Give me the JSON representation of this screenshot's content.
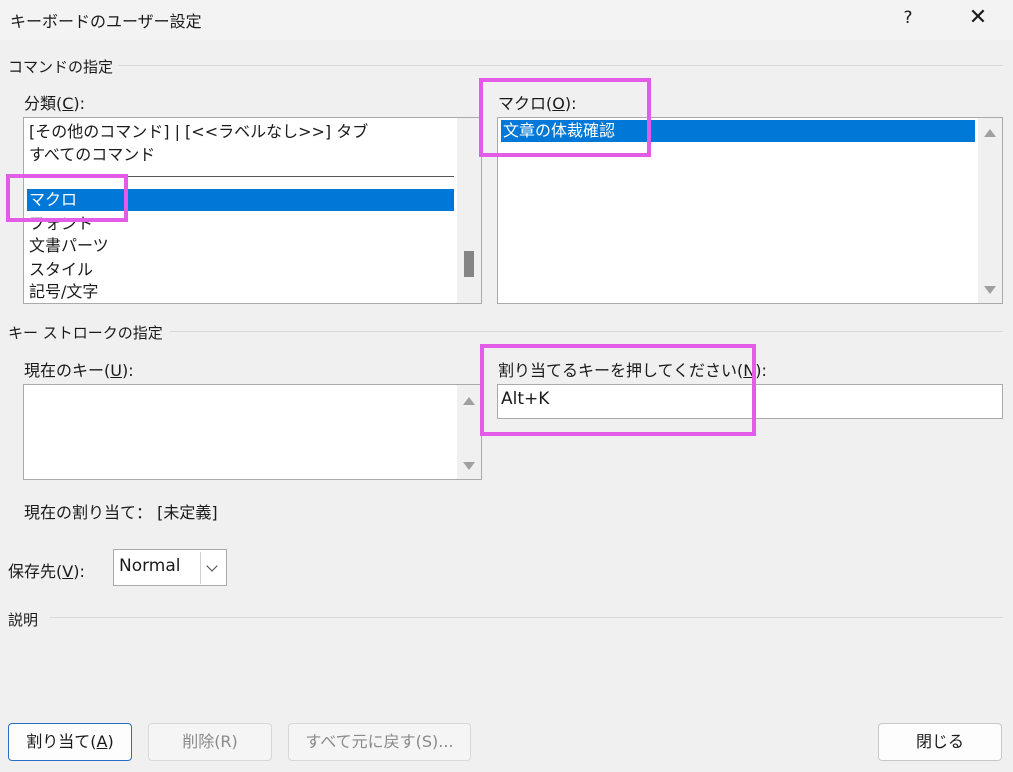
{
  "window": {
    "title": "キーボードのユーザー設定",
    "help": "?",
    "close": "✕"
  },
  "commands_group": {
    "label": "コマンドの指定",
    "categories": {
      "label_prefix": "分類(",
      "label_key": "C",
      "label_suffix": "):",
      "items": [
        {
          "text": "[その他のコマンド] | [<<ラベルなし>>] タブ",
          "selected": false
        },
        {
          "text": "すべてのコマンド",
          "selected": false
        },
        {
          "text": "マクロ",
          "selected": true
        },
        {
          "text": "フォント",
          "selected": false
        },
        {
          "text": "文書パーツ",
          "selected": false
        },
        {
          "text": "スタイル",
          "selected": false
        },
        {
          "text": "記号/文字",
          "selected": false
        }
      ]
    },
    "macros": {
      "label_prefix": "マクロ(",
      "label_key": "O",
      "label_suffix": "):",
      "items": [
        {
          "text": "文章の体裁確認",
          "selected": true
        }
      ]
    }
  },
  "keystroke_group": {
    "label": "キー ストロークの指定",
    "current_keys": {
      "label_prefix": "現在のキー(",
      "label_key": "U",
      "label_suffix": "):"
    },
    "new_key": {
      "label_prefix": "割り当てるキーを押してください(",
      "label_key": "N",
      "label_suffix": "):",
      "value": "Alt+K"
    }
  },
  "current_assignment": {
    "label": "現在の割り当て：",
    "value": "[未定義]"
  },
  "save_in": {
    "label_prefix": "保存先(",
    "label_key": "V",
    "label_suffix": "):",
    "value": "Normal"
  },
  "description": {
    "label": "説明"
  },
  "buttons": {
    "assign": {
      "prefix": "割り当て(",
      "key": "A",
      "suffix": ")"
    },
    "delete": "削除(R)",
    "reset_all": "すべて元に戻す(S)...",
    "close": "閉じる"
  },
  "colors": {
    "selection": "#0078d7",
    "highlight": "#e25ce8",
    "background": "#f0f0f0"
  }
}
